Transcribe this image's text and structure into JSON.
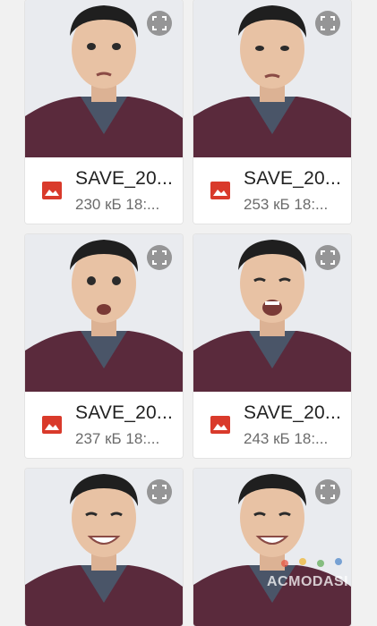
{
  "files": [
    {
      "name": "SAVE_20...",
      "meta": "230 кБ 18:..."
    },
    {
      "name": "SAVE_20...",
      "meta": "253 кБ 18:..."
    },
    {
      "name": "SAVE_20...",
      "meta": "237 кБ 18:..."
    },
    {
      "name": "SAVE_20...",
      "meta": "243 кБ 18:..."
    },
    {
      "name": "",
      "meta": ""
    },
    {
      "name": "",
      "meta": ""
    }
  ],
  "watermark": "ACMODASI",
  "colors": {
    "image_icon": "#d93a2b",
    "shirt": "#5a2a3c",
    "tshirt": "#4a5568",
    "skin": "#e8c2a4",
    "hair": "#1f1f1f",
    "background": "#e9ebef"
  },
  "icons": {
    "expand": "expand-icon",
    "file_type": "image-file-icon"
  }
}
